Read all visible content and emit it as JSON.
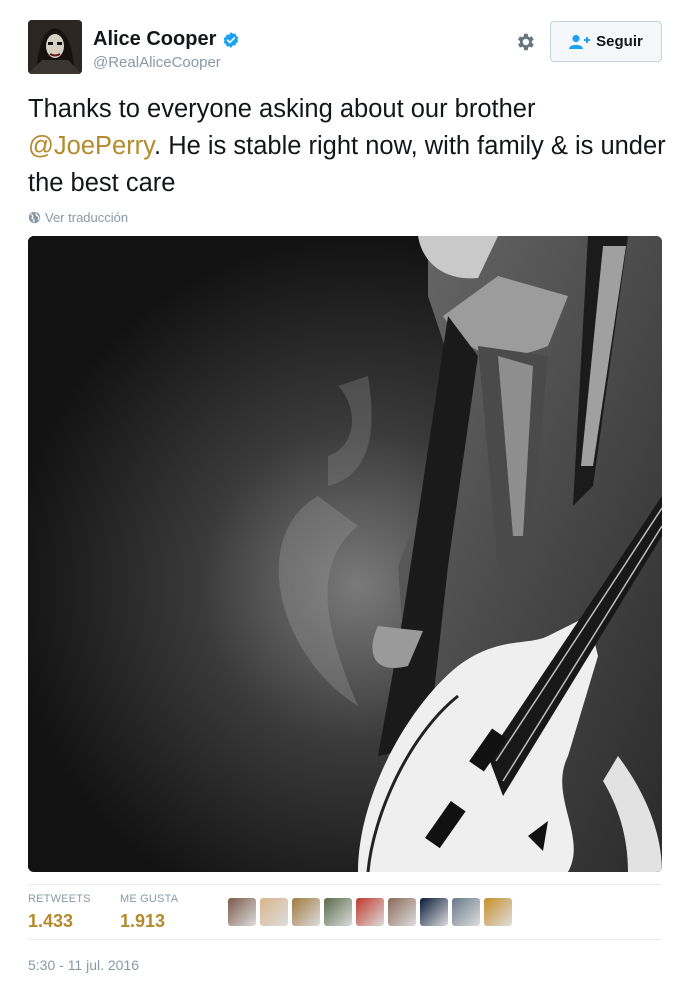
{
  "author": {
    "name": "Alice Cooper",
    "handle": "@RealAliceCooper",
    "verified": true
  },
  "actions": {
    "follow_label": "Seguir"
  },
  "tweet": {
    "text_before": "Thanks to everyone asking about our brother ",
    "mention": "@JoePerry",
    "text_after": ". He is stable right now, with family & is under the best care",
    "translate_label": "Ver traducción"
  },
  "stats": {
    "retweets_label": "RETWEETS",
    "retweets_value": "1.433",
    "likes_label": "ME GUSTA",
    "likes_value": "1.913"
  },
  "likers": [
    {
      "color": "#7a5a4a"
    },
    {
      "color": "#d9b58a"
    },
    {
      "color": "#a07a40"
    },
    {
      "color": "#5a6a4a"
    },
    {
      "color": "#c0392b"
    },
    {
      "color": "#8a6a5a"
    },
    {
      "color": "#0a1a3a"
    },
    {
      "color": "#6a7a8a"
    },
    {
      "color": "#c8902a"
    }
  ],
  "timestamp": "5:30 - 11 jul. 2016",
  "colors": {
    "accent": "#b48a2d",
    "verified": "#1da1f2",
    "muted": "#8899a6"
  }
}
